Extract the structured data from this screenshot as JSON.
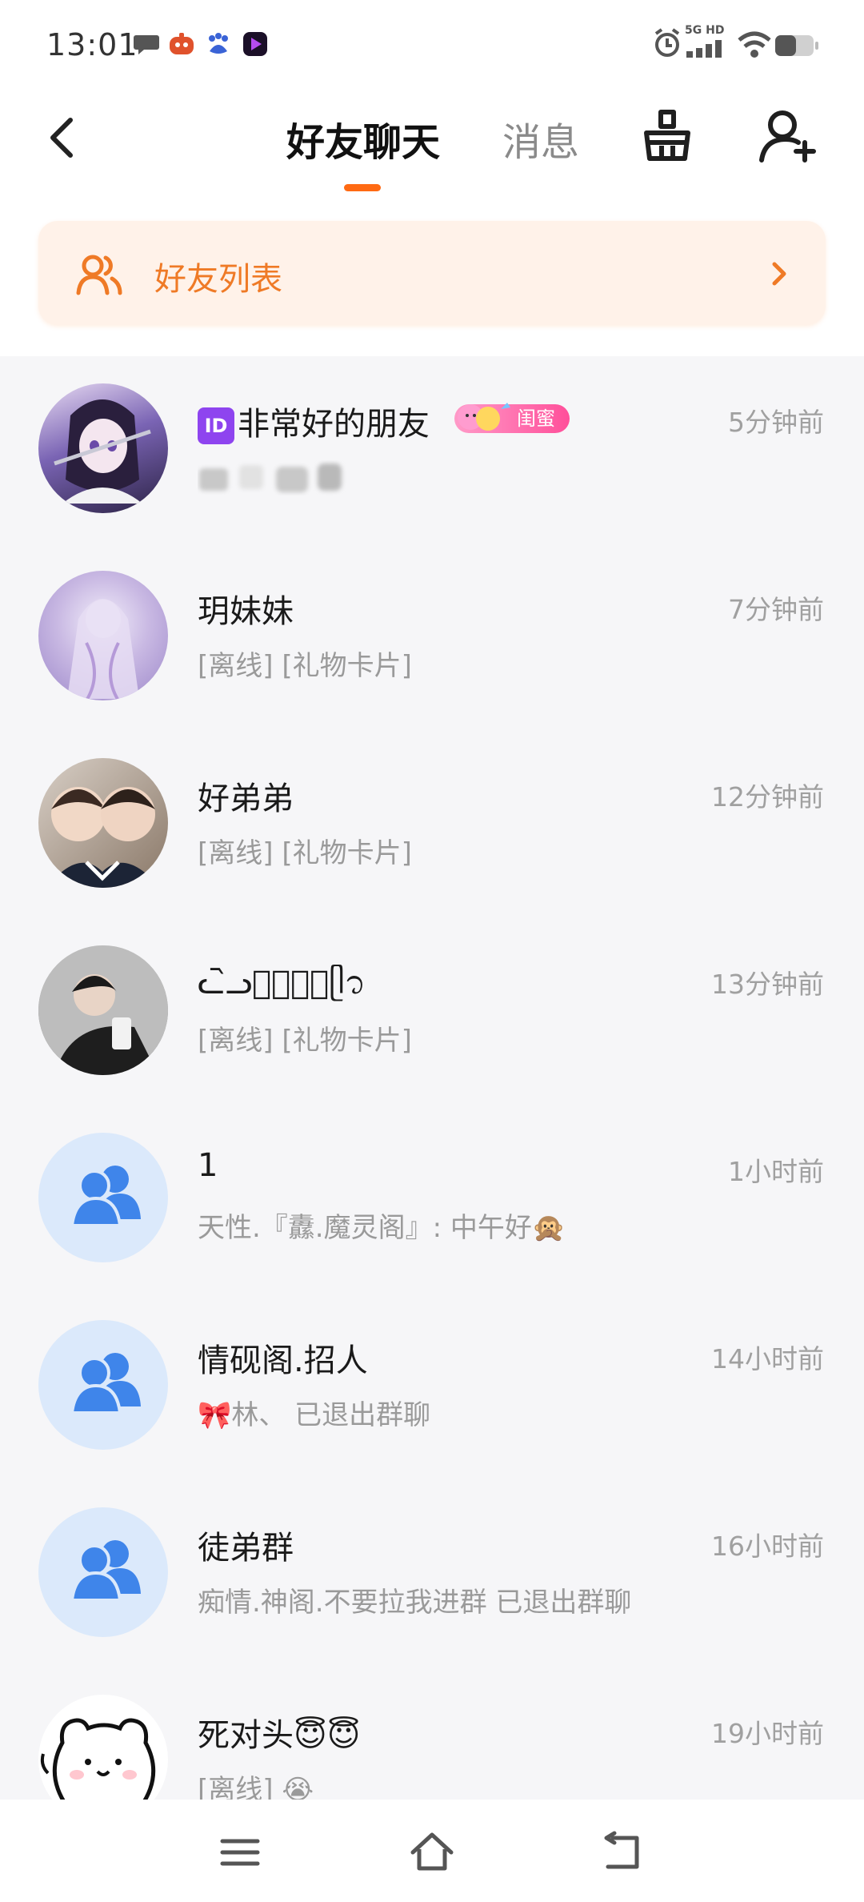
{
  "status_bar": {
    "time": "13:01",
    "network_label": "5G HD"
  },
  "header": {
    "tab_friends_chat": "好友聊天",
    "tab_messages": "消息"
  },
  "friends_list_card": {
    "label": "好友列表"
  },
  "chats": [
    {
      "name_text": "非常好的朋友",
      "id_badge": "ID",
      "pill_label": "闺蜜",
      "preview": "",
      "time": "5分钟前",
      "avatar": "anime-character-avatar"
    },
    {
      "name_text": "玥妹妹",
      "preview": "[离线] [礼物卡片]",
      "time": "7分钟前",
      "avatar": "purple-illustration-avatar"
    },
    {
      "name_text": "好弟弟",
      "preview": "[离线] [礼物卡片]",
      "time": "12分钟前",
      "avatar": "photo-avatar"
    },
    {
      "name_text": "ᓚ᷆ᓗ星ᷤ辰ᷤᥫ᭡",
      "preview": "[离线] [礼物卡片]",
      "time": "13分钟前",
      "avatar": "dark-photo-avatar"
    },
    {
      "name_text": "1",
      "preview": "天性.『纛.魔灵阁』: 中午好🙊",
      "time": "1小时前",
      "avatar": "group-icon"
    },
    {
      "name_text": "情砚阁.招人",
      "preview": "🎀林、 已退出群聊",
      "time": "14小时前",
      "avatar": "group-icon"
    },
    {
      "name_text": "徒弟群",
      "preview": "痴情.神阁.不要拉我进群 已退出群聊",
      "time": "16小时前",
      "avatar": "group-icon"
    },
    {
      "name_text": "死对头😇😇",
      "preview": "[离线] 😭",
      "time": "19小时前",
      "avatar": "bear-sticker-avatar"
    }
  ],
  "colors": {
    "accent": "#ff6a13",
    "card_bg": "#fff2e9",
    "card_text": "#ef7a26",
    "group_avatar_bg": "#dbe9fb",
    "group_icon": "#3f85ea"
  }
}
